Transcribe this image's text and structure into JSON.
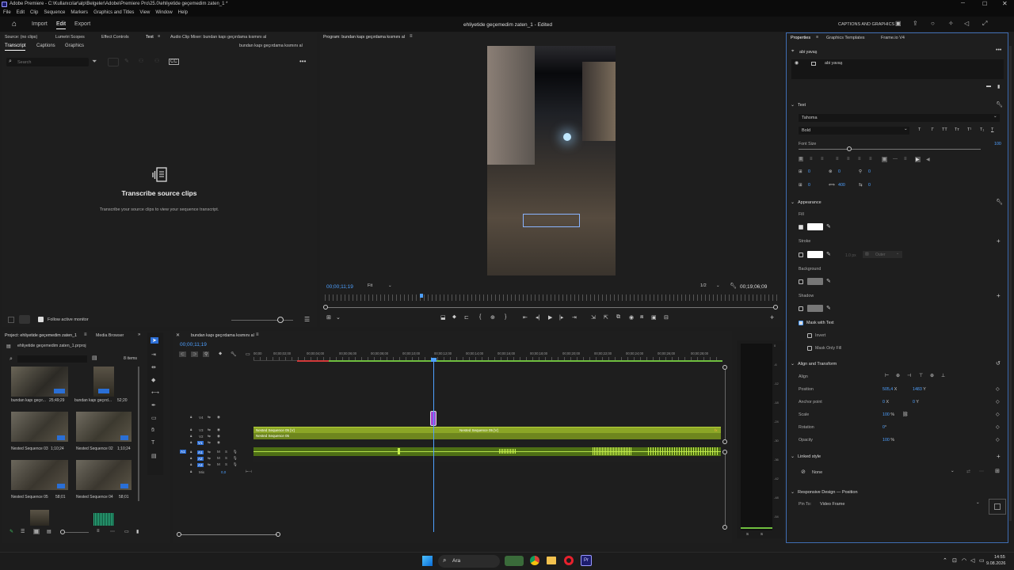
{
  "titlebar": {
    "title": "Adobe Premiere - C:\\Kullanıcılar\\alp\\Belgeler\\Adobe\\Premiere Pro\\25.0\\ehliyetide geçemedim zaten_1 *"
  },
  "menubar": [
    "File",
    "Edit",
    "Clip",
    "Sequence",
    "Markers",
    "Graphics and Titles",
    "View",
    "Window",
    "Help"
  ],
  "apptabs": {
    "import": "Import",
    "edit": "Edit",
    "export": "Export",
    "project_name": "ehliyetide geçemedim zaten_1",
    "project_status": "- Edited",
    "captions_button": "CAPTIONS AND GRAPHICS"
  },
  "source_panel": {
    "tabs": [
      "Source: (no clips)",
      "Lumetri Scopes",
      "Effect Controls",
      "Text",
      "Audio Clip Mixer: bundan kapı geçırdama kısmını al"
    ],
    "sequence_label": "bundan kapı geçırdama kısmını al",
    "subtabs": [
      "Transcript",
      "Captions",
      "Graphics"
    ],
    "search_placeholder": "Search",
    "empty_title": "Transcribe source clips",
    "empty_text": "Transcribe your source clips to view your sequence transcript.",
    "follow_label": "Follow active monitor"
  },
  "program": {
    "tab": "Program: bundan kapı geçırdama kısmını al",
    "timecode": "00;00;11;19",
    "fit": "Fit",
    "resolution": "1/2",
    "duration": "00;19;06;09"
  },
  "properties": {
    "tabs": [
      "Properties",
      "Graphics Templates",
      "Frame.io V4"
    ],
    "layer_group": "abi yavaş",
    "layer_item": "abi yavaş",
    "text_section": "Text",
    "font": "Tahoma",
    "style": "Bold",
    "font_size_label": "Font Size",
    "font_size_value": "100",
    "tracking": [
      "0",
      "0",
      "0",
      "0",
      "400",
      "0"
    ],
    "appearance_section": "Appearance",
    "fill": "Fill",
    "stroke": "Stroke",
    "stroke_width": "1.0",
    "stroke_unit": "px",
    "stroke_type": "Outer",
    "background": "Background",
    "shadow": "Shadow",
    "mask_with_text": "Mask with Text",
    "invert": "Invert",
    "mask_only_fill": "Mask Only Fill",
    "align_section": "Align and Transform",
    "align": "Align",
    "position_label": "Position",
    "position_x": "505,4",
    "position_x_unit": "X",
    "position_y": "1483",
    "position_y_unit": "Y",
    "anchor_label": "Anchor point",
    "anchor_x": "0",
    "anchor_x_unit": "X",
    "anchor_y": "0",
    "anchor_y_unit": "Y",
    "scale_label": "Scale",
    "scale_value": "100",
    "scale_unit": "%",
    "rotation_label": "Rotation",
    "rotation_value": "0",
    "rotation_unit": "°",
    "opacity_label": "Opacity",
    "opacity_value": "100",
    "opacity_unit": "%",
    "linked_section": "Linked style",
    "linked_value": "None",
    "responsive_section": "Responsive Design — Position",
    "pin_label": "Pin To:",
    "pin_value": "Video Frame"
  },
  "project": {
    "tabs": [
      "Project: ehliyetide geçemedim zaten_1",
      "Media Browser"
    ],
    "file": "ehliyetide geçemedim zaten_1.prproj",
    "items_count": "8 items",
    "clips": [
      {
        "name": "bundan kapı geçır...",
        "dur": "25;49;29"
      },
      {
        "name": "bundan kapı geçırd...",
        "dur": "52;20"
      },
      {
        "name": "Nested Sequence 03",
        "dur": "1;10;24"
      },
      {
        "name": "Nested Sequence 02",
        "dur": "1;10;24"
      },
      {
        "name": "Nested Sequence 05",
        "dur": "58;01"
      },
      {
        "name": "Nested Sequence 04",
        "dur": "58;01"
      }
    ]
  },
  "timeline": {
    "tab": "bundan kapı geçırdama kısmını al",
    "timecode": "00;00;11;19",
    "ruler": [
      "00;00",
      "00;00;02;00",
      "00;00;04;00",
      "00;00;06;00",
      "00;00;08;00",
      "00;00;10;00",
      "00;00;12;00",
      "00;00;14;00",
      "00;00;16;00",
      "00;00;18;00",
      "00;00;20;00",
      "00;00;22;00",
      "00;00;24;00",
      "00;00;26;00",
      "00;00;28;00"
    ],
    "tracks": [
      "V4",
      "V3",
      "V2",
      "V1",
      "A1",
      "A2",
      "A3",
      "Mix"
    ],
    "mix_value": "0,0",
    "clip_v3_a": "Nested Sequence 05 [V]",
    "clip_v3_b": "Nested Sequence 05 [V]",
    "clip_v2": "Nested Sequence 05",
    "meter_scale": [
      "0",
      "-6",
      "-12",
      "-18",
      "-24",
      "-30",
      "-36",
      "-42",
      "-48",
      "-54"
    ],
    "meter_s": [
      "S",
      "S"
    ]
  },
  "taskbar": {
    "search": "Ara",
    "time": "14:55",
    "date": "9.08.2026"
  }
}
